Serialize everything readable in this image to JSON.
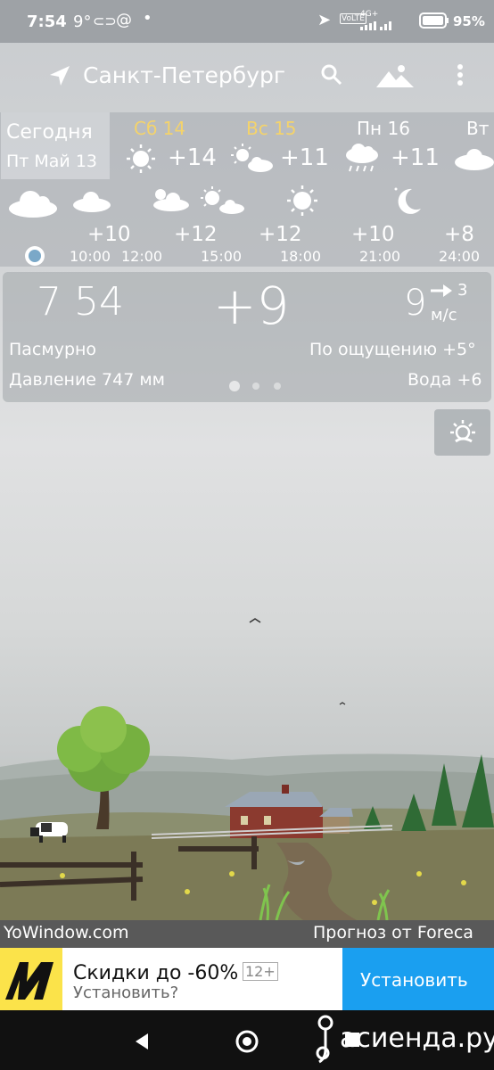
{
  "status": {
    "time": "7:54",
    "temp": "9°",
    "battery": "95%",
    "net": "4G+"
  },
  "header": {
    "city": "Санкт-Петербург"
  },
  "days": {
    "today_label": "Сегодня",
    "today_date": "Пт Май 13",
    "items": [
      {
        "name": "Сб 14",
        "temp": "+14",
        "color": "#f4d36b"
      },
      {
        "name": "Вс 15",
        "temp": "+11",
        "color": "#f4d36b"
      },
      {
        "name": "Пн 16",
        "temp": "+11",
        "color": "#ffffff"
      },
      {
        "name": "Вт",
        "temp": "",
        "color": "#ffffff"
      }
    ]
  },
  "hours": [
    {
      "temp": "+10",
      "time": "10:00"
    },
    {
      "temp": "",
      "time": "12:00"
    },
    {
      "temp": "+12",
      "time": "15:00"
    },
    {
      "temp": "+12",
      "time": "18:00"
    },
    {
      "temp": "+10",
      "time": "21:00"
    },
    {
      "temp": "+8",
      "time": "24:00"
    }
  ],
  "current": {
    "time": "7 54",
    "temp": "+9",
    "wind_speed": "9",
    "wind_gust": "3",
    "wind_unit": "м/с",
    "condition": "Пасмурно",
    "feels_like": "По ощущению +5°",
    "pressure": "Давление 747 мм",
    "water": "Вода +6"
  },
  "footer": {
    "brand": "YoWindow.com",
    "forecast_by": "Прогноз от Foreca"
  },
  "ad": {
    "title": "Скидки до -60%",
    "age": "12+",
    "subtitle": "Установить?",
    "install": "Установить"
  },
  "watermark": "асиенда.ру"
}
